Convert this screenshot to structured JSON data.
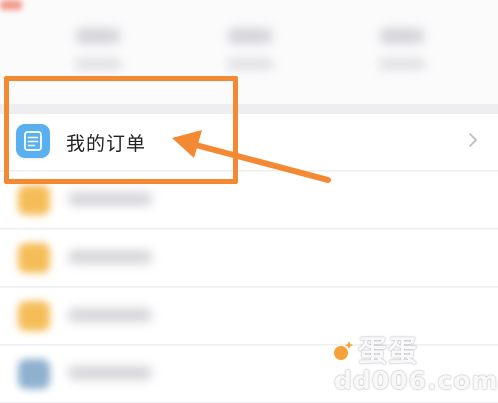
{
  "menu": {
    "my_orders": {
      "label": "我的订单",
      "icon": "order-list-icon",
      "icon_color": "#5ab0ee"
    }
  },
  "annotation": {
    "highlight_color": "#f38a33"
  },
  "watermark": {
    "brand": "蛋蛋",
    "url": "dd006.com"
  }
}
